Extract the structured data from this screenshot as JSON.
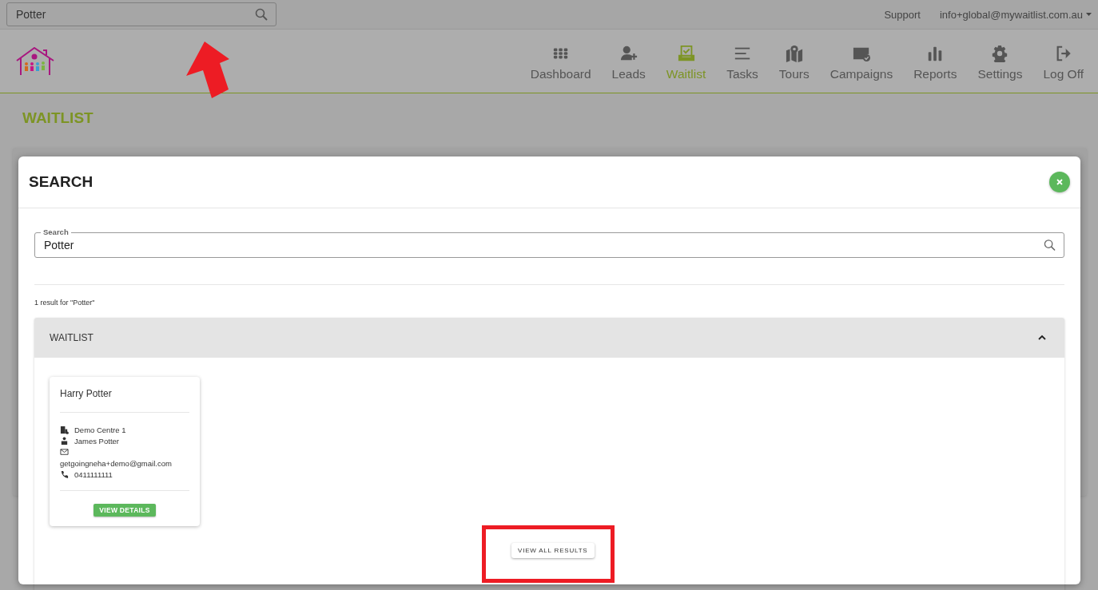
{
  "top_bar": {
    "search": {
      "value": "Potter"
    },
    "support_link": "Support",
    "account_menu": "info+global@mywaitlist.com.au"
  },
  "nav": [
    {
      "label": "Dashboard",
      "selected": false
    },
    {
      "label": "Leads",
      "selected": false
    },
    {
      "label": "Waitlist",
      "selected": true
    },
    {
      "label": "Tasks",
      "selected": false
    },
    {
      "label": "Tours",
      "selected": false
    },
    {
      "label": "Campaigns",
      "selected": false
    },
    {
      "label": "Reports",
      "selected": false
    },
    {
      "label": "Settings",
      "selected": false
    },
    {
      "label": "Log Off",
      "selected": false
    }
  ],
  "page_title": "WAITLIST",
  "modal": {
    "title": "SEARCH",
    "search": {
      "label": "Search",
      "value": "Potter"
    },
    "result_summary": "1 result for \"Potter\"",
    "sections": [
      {
        "title": "WAITLIST",
        "expanded": true,
        "cards": [
          {
            "name": "Harry Potter",
            "centre": "Demo Centre 1",
            "contact": "James Potter",
            "email": "getgoingneha+demo@gmail.com",
            "phone": "0411111111",
            "button": "VIEW DETAILS"
          }
        ]
      }
    ],
    "view_all_button": "VIEW ALL RESULTS"
  }
}
